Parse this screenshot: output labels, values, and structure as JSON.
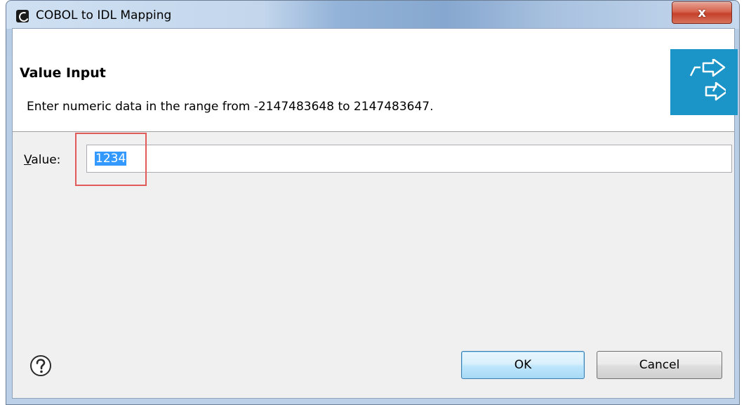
{
  "window": {
    "title": "COBOL to IDL Mapping",
    "close_label": "x"
  },
  "header": {
    "title": "Value Input",
    "message": "Enter numeric data in the range from -2147483648 to 2147483647."
  },
  "form": {
    "value_label_mnemonic": "V",
    "value_label_rest": "alue:",
    "value": "1234"
  },
  "buttons": {
    "ok": "OK",
    "cancel": "Cancel"
  },
  "icons": {
    "app": "eclipse-app-icon",
    "banner": "mapping-arrows-icon",
    "help": "help-icon"
  },
  "colors": {
    "banner_bg": "#1b94c7",
    "selection": "#3399ff",
    "highlight": "#e15b5b"
  }
}
